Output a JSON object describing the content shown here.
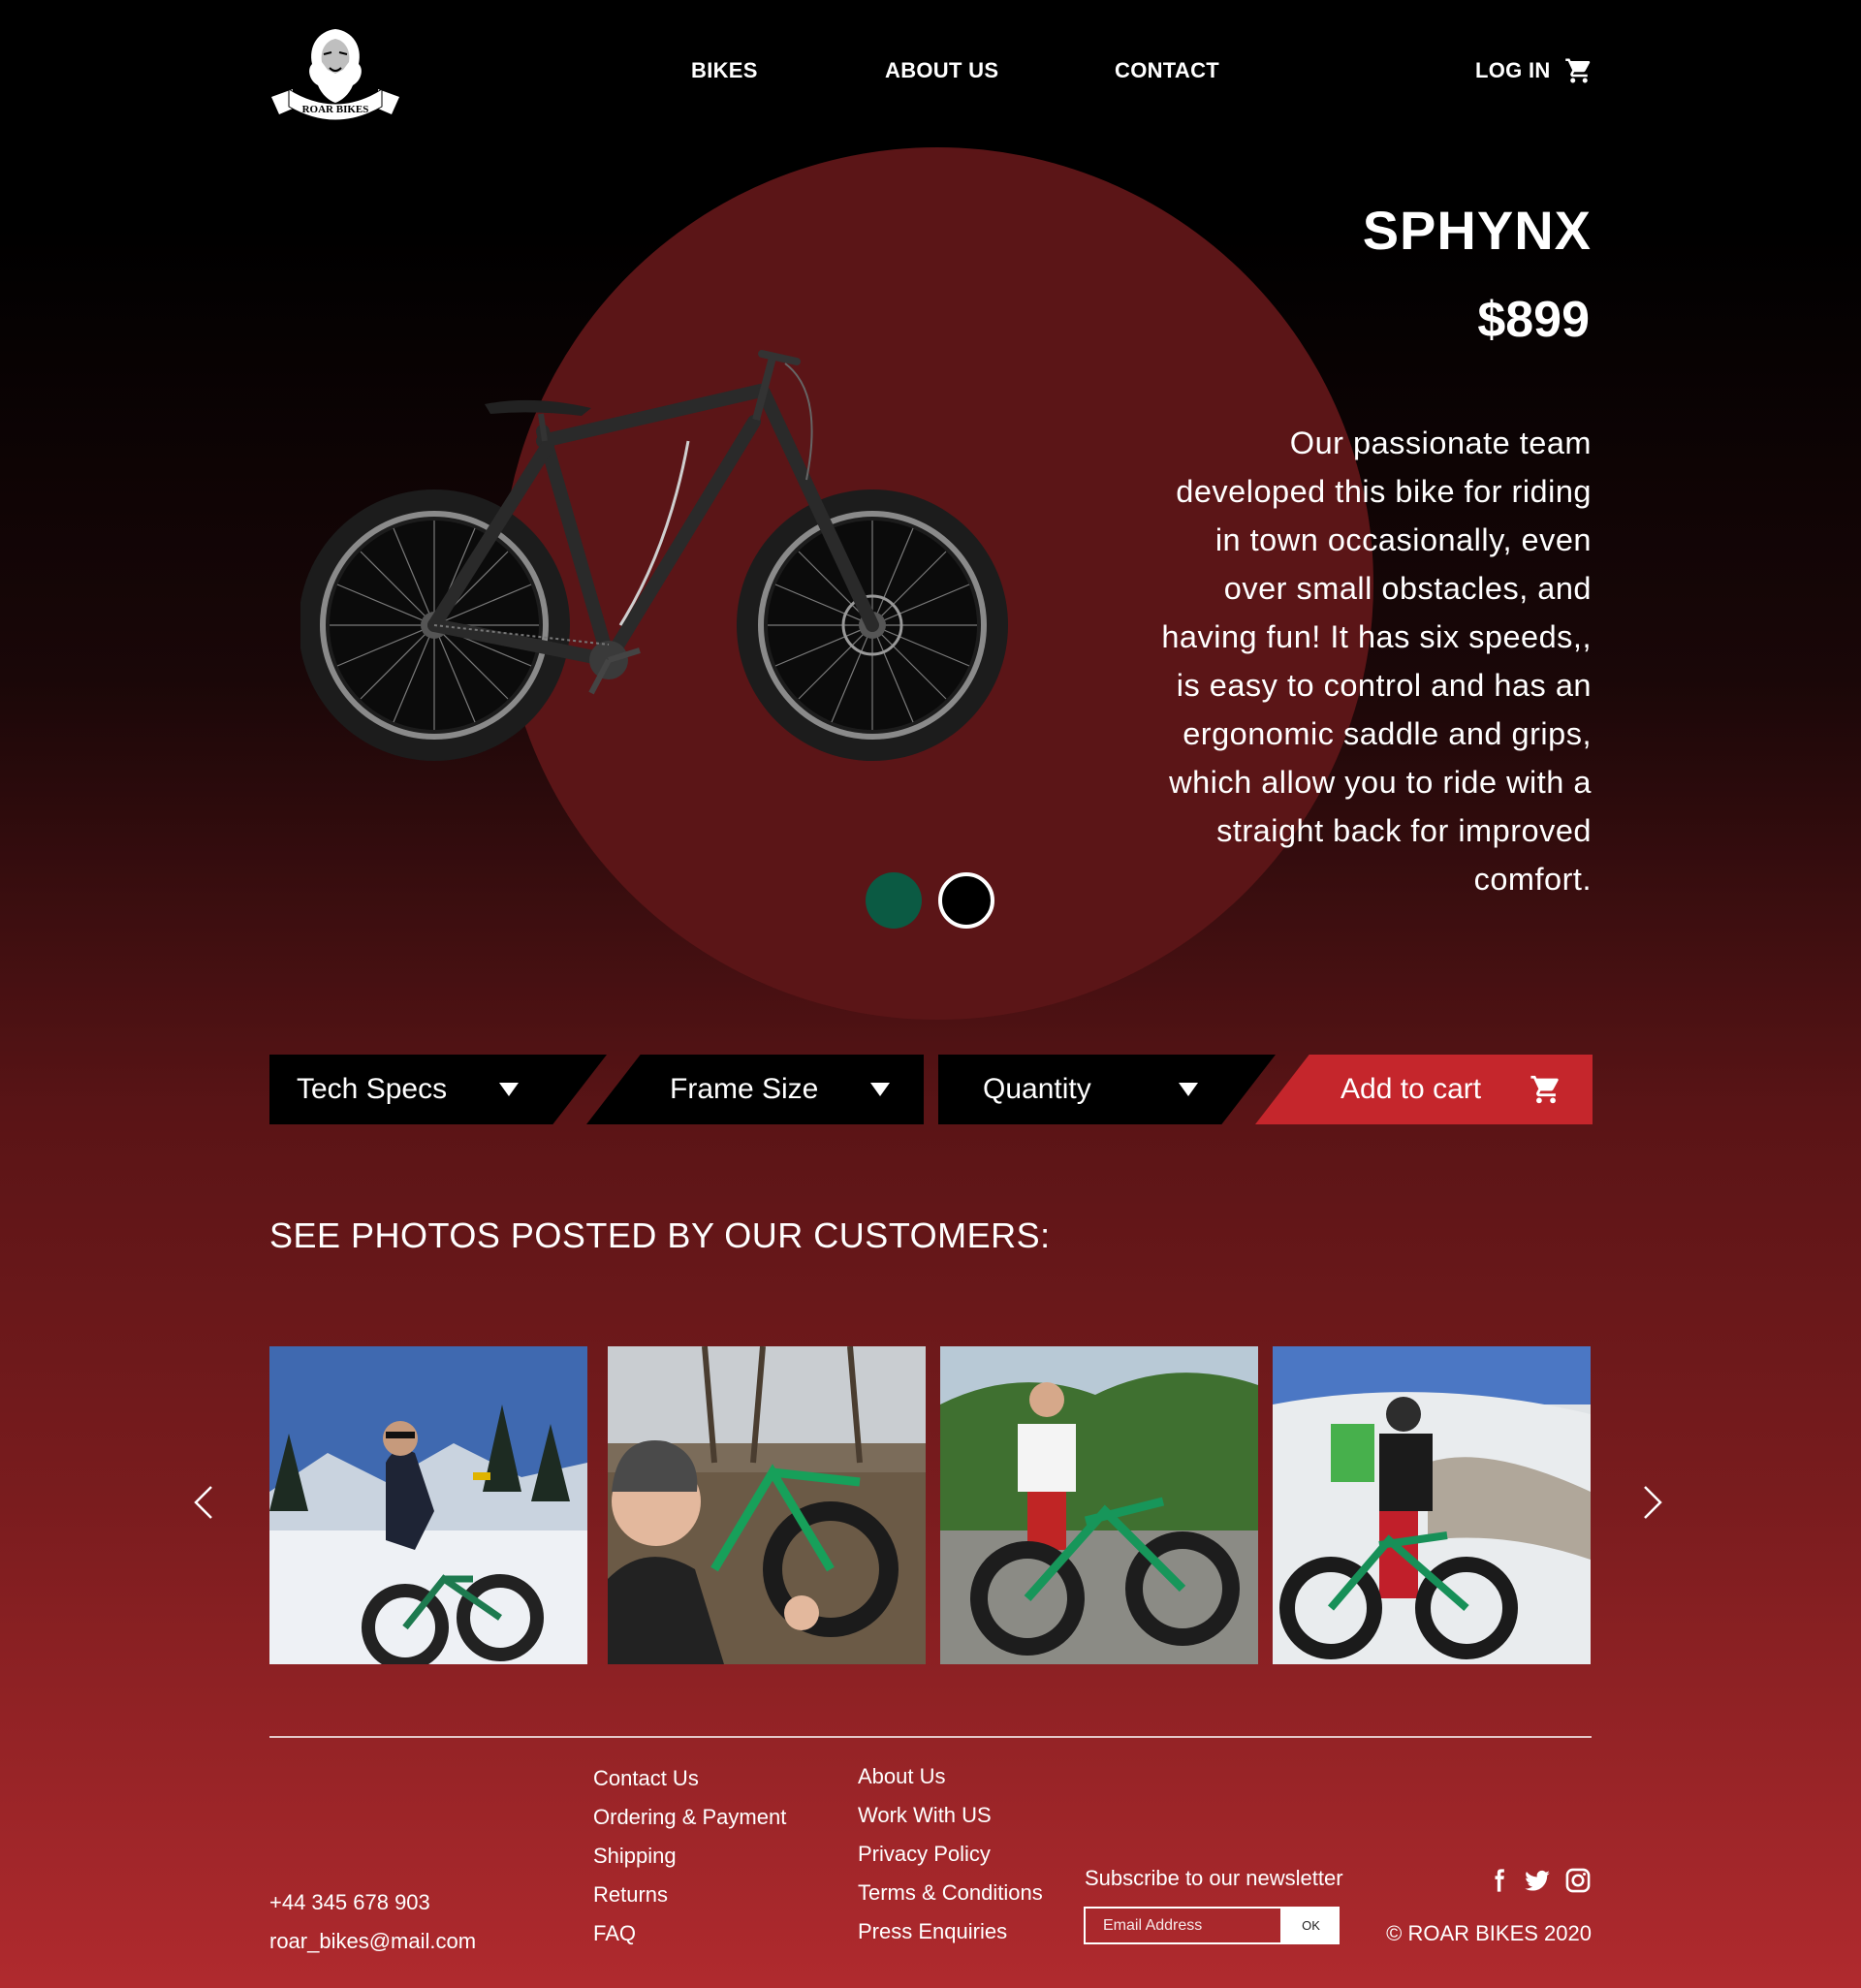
{
  "nav": {
    "brand": "ROAR BIKES",
    "links": [
      "BIKES",
      "ABOUT US",
      "CONTACT"
    ],
    "login": "LOG IN",
    "cart_icon": "cart-icon"
  },
  "product": {
    "name": "SPHYNX",
    "price": "$899",
    "description": "Our passionate team developed this bike for riding in town occasionally, even over small obstacles, and having fun! It has six speeds,, is easy to control and has an ergonomic saddle and grips, which allow you to ride with a straight back for improved comfort.",
    "colors": [
      "#0b5a43",
      "#000000"
    ]
  },
  "options": {
    "specs": "Tech Specs",
    "frame": "Frame Size",
    "quantity": "Quantity",
    "add_to_cart": "Add to cart"
  },
  "customers": {
    "title": "SEE PHOTOS POSTED BY OUR CUSTOMERS:",
    "photos": [
      "snow-rider-photo",
      "selfie-with-bike-photo",
      "standing-with-bike-photo",
      "hiker-with-bike-photo"
    ]
  },
  "footer": {
    "phone": "+44 345 678 903",
    "email": "roar_bikes@mail.com",
    "col1": [
      "Contact Us",
      "Ordering & Payment",
      "Shipping",
      "Returns",
      "FAQ"
    ],
    "col2": [
      "About Us",
      "Work With US",
      "Privacy Policy",
      "Terms & Conditions",
      "Press Enquiries"
    ],
    "newsletter_label": "Subscribe to our newsletter",
    "email_placeholder": "Email Address",
    "ok": "OK",
    "social": [
      "facebook-icon",
      "twitter-icon",
      "instagram-icon"
    ],
    "copyright": "© ROAR BIKES 2020"
  },
  "colors": {
    "accent_red": "#c5262c",
    "hero_circle": "#5b1517"
  }
}
